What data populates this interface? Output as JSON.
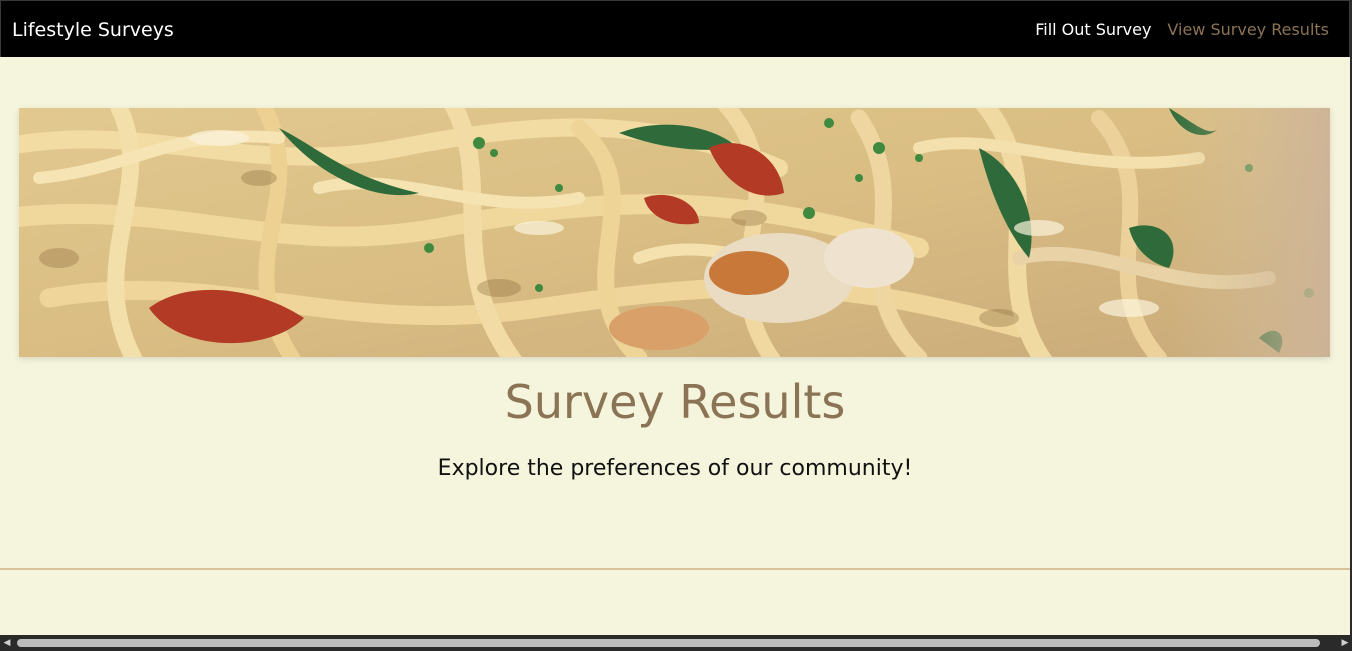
{
  "header": {
    "brand": "Lifestyle Surveys",
    "nav": {
      "fill_out": "Fill Out Survey",
      "view_results": "View Survey Results"
    }
  },
  "main": {
    "hero_image": "creamy-pasta-photo",
    "title": "Survey Results",
    "subtitle": "Explore the preferences of our community!"
  },
  "colors": {
    "page_background": "#f5f4dc",
    "navbar_background": "#000000",
    "accent": "#8b7355",
    "divider": "#d7c29e"
  }
}
